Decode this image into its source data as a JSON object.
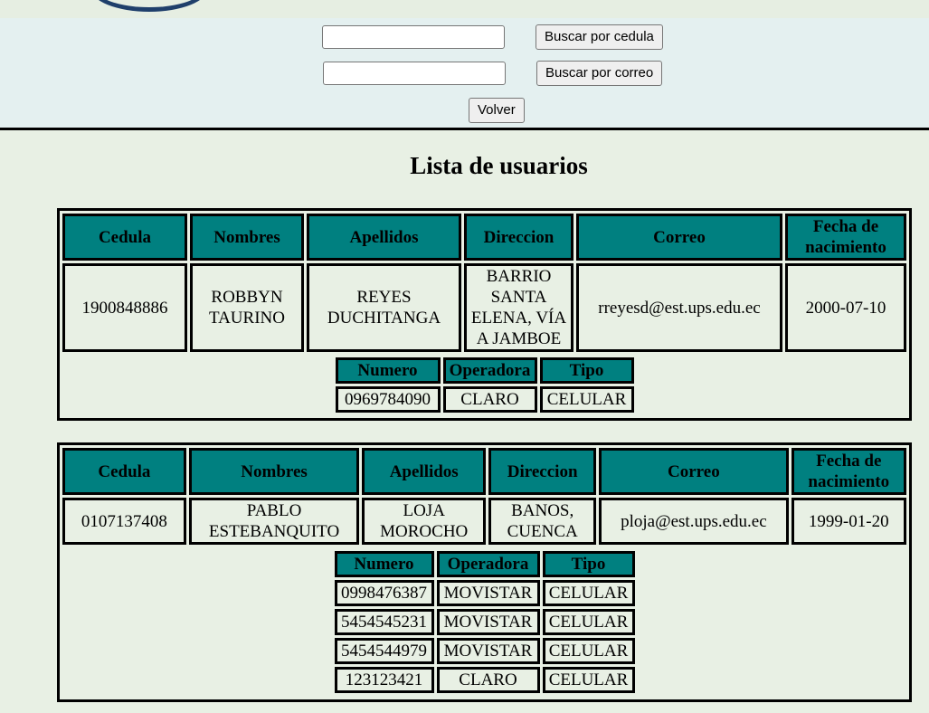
{
  "search": {
    "cedula_value": "",
    "correo_value": "",
    "cedula_button": "Buscar por cedula",
    "correo_button": "Buscar por correo",
    "back_button": "Volver"
  },
  "title": "Lista de usuarios",
  "headers": {
    "cedula": "Cedula",
    "nombres": "Nombres",
    "apellidos": "Apellidos",
    "direccion": "Direccion",
    "correo": "Correo",
    "fecha": "Fecha de nacimiento"
  },
  "phone_headers": {
    "numero": "Numero",
    "operadora": "Operadora",
    "tipo": "Tipo"
  },
  "users": [
    {
      "cedula": "1900848886",
      "nombres": "ROBBYN TAURINO",
      "apellidos": "REYES DUCHITANGA",
      "direccion": "BARRIO SANTA ELENA, VÍA A JAMBOE",
      "correo": "rreyesd@est.ups.edu.ec",
      "fecha": "2000-07-10",
      "phones": [
        {
          "numero": "0969784090",
          "operadora": "CLARO",
          "tipo": "CELULAR"
        }
      ]
    },
    {
      "cedula": "0107137408",
      "nombres": "PABLO ESTEBANQUITO",
      "apellidos": "LOJA MOROCHO",
      "direccion": "BANOS, CUENCA",
      "correo": "ploja@est.ups.edu.ec",
      "fecha": "1999-01-20",
      "phones": [
        {
          "numero": "0998476387",
          "operadora": "MOVISTAR",
          "tipo": "CELULAR"
        },
        {
          "numero": "5454545231",
          "operadora": "MOVISTAR",
          "tipo": "CELULAR"
        },
        {
          "numero": "5454544979",
          "operadora": "MOVISTAR",
          "tipo": "CELULAR"
        },
        {
          "numero": "123123421",
          "operadora": "CLARO",
          "tipo": "CELULAR"
        }
      ]
    }
  ]
}
